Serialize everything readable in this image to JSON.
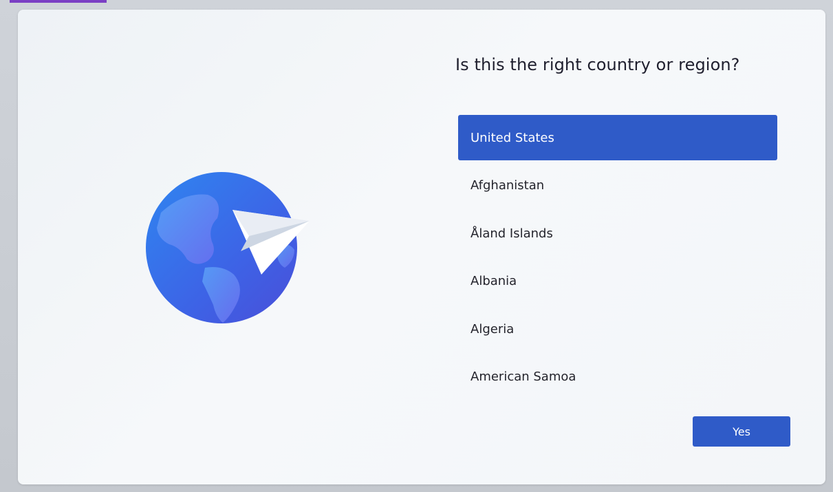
{
  "setup": {
    "question": "Is this the right country or region?",
    "countries": [
      {
        "label": "United States",
        "selected": true
      },
      {
        "label": "Afghanistan",
        "selected": false
      },
      {
        "label": "Åland Islands",
        "selected": false
      },
      {
        "label": "Albania",
        "selected": false
      },
      {
        "label": "Algeria",
        "selected": false
      },
      {
        "label": "American Samoa",
        "selected": false
      }
    ],
    "yes_label": "Yes"
  },
  "colors": {
    "accent": "#2f5bc8",
    "globe": "#3a6ff0",
    "purple_strip": "#7b3fc4"
  },
  "icons": {
    "illustration": "globe-paper-plane-icon"
  }
}
